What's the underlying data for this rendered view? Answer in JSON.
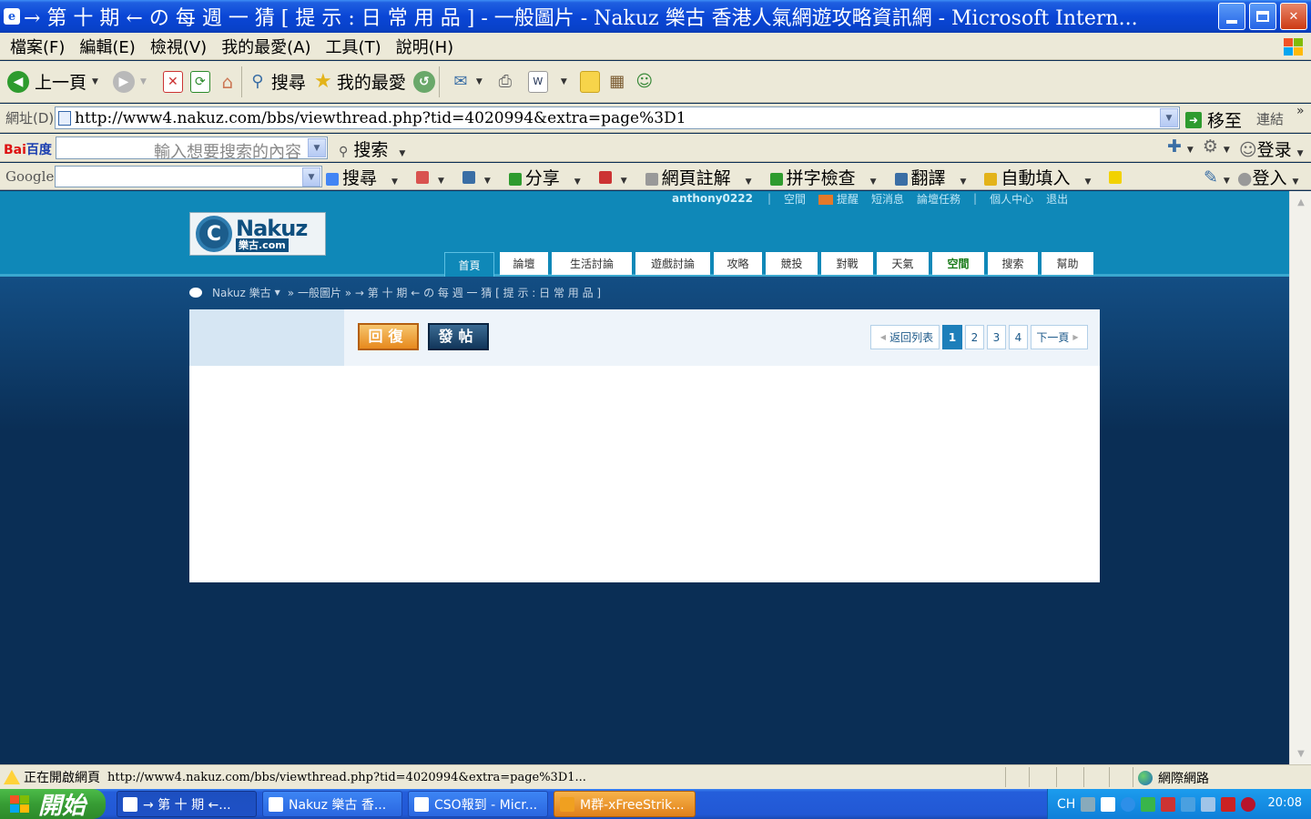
{
  "window": {
    "title": "→ 第 十 期 ← の 每 週 一 猜 [ 提 示 : 日 常 用 品 ] - 一般圖片 - Nakuz 樂古 香港人氣網遊攻略資訊網 - Microsoft Intern..."
  },
  "menu": {
    "items": [
      "檔案(F)",
      "編輯(E)",
      "檢視(V)",
      "我的最愛(A)",
      "工具(T)",
      "說明(H)"
    ]
  },
  "toolbar": {
    "back_label": "上一頁",
    "search_label": "搜尋",
    "favorites_label": "我的最愛"
  },
  "address": {
    "label": "網址(D)",
    "url": "http://www4.nakuz.com/bbs/viewthread.php?tid=4020994&extra=page%3D1",
    "go_label": "移至",
    "links_label": "連結"
  },
  "baidu": {
    "logo_a": "Bai",
    "logo_b": "百度",
    "placeholder": "輸入想要搜索的內容",
    "search_label": "搜索",
    "login_label": "登录"
  },
  "google": {
    "logo": "Google",
    "search_label": "搜尋",
    "share_label": "分享",
    "annotate_label": "網頁註解",
    "spellcheck_label": "拼字檢查",
    "translate_label": "翻譯",
    "autofill_label": "自動填入",
    "login_label": "登入"
  },
  "site": {
    "username": "anthony0222",
    "user_links": [
      "空間",
      "提醒",
      "短消息",
      "論壇任務",
      "個人中心",
      "退出"
    ],
    "logo_text": "Nakuz",
    "logo_sub": "樂古.com",
    "logo_mark": "C",
    "tabs": [
      "首頁",
      "論壇",
      "生活討論",
      "遊戲討論",
      "攻略",
      "競投",
      "對戰",
      "天氣",
      "空間",
      "搜索",
      "幫助"
    ],
    "breadcrumb": {
      "site": "Nakuz 樂古",
      "path": "» 一般圖片 » → 第 十 期 ← の 每 週 一 猜 [ 提 示 : 日 常 用 品 ]"
    },
    "reply_label": "回復",
    "post_label": "發帖",
    "pager": {
      "back_label": "返回列表",
      "pages": [
        "1",
        "2",
        "3",
        "4"
      ],
      "next_label": "下一頁"
    }
  },
  "status": {
    "message": "正在開啟網頁",
    "url": "http://www4.nakuz.com/bbs/viewthread.php?tid=4020994&extra=page%3D1...",
    "zone": "網際網路"
  },
  "taskbar": {
    "start_label": "開始",
    "tasks": [
      "→ 第 十 期 ←...",
      "Nakuz 樂古 香...",
      "CSO報到 - Micr...",
      "M群-xFreeStrik..."
    ],
    "lang": "CH",
    "clock": "20:08"
  },
  "colors": {
    "header": "#0f88b8",
    "page_bg": "#0a2e55",
    "active_tab": "#0f88b8",
    "reply_btn": "#e7891d",
    "post_btn": "#12365a"
  }
}
